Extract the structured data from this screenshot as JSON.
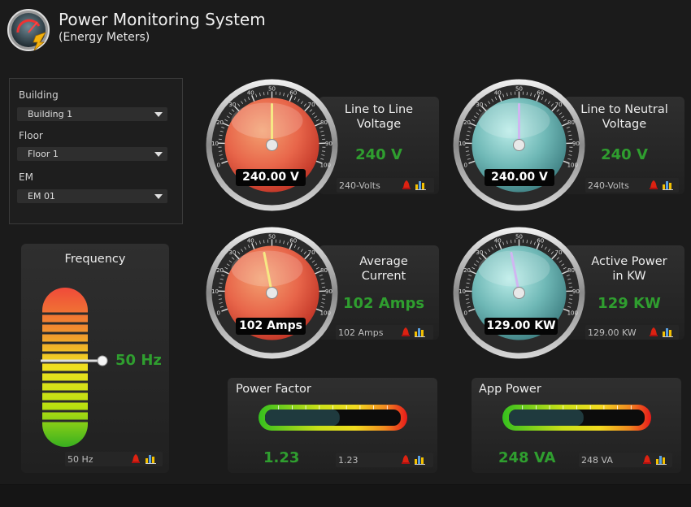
{
  "header": {
    "title": "Power Monitoring System",
    "subtitle": "(Energy Meters)",
    "logo_icon": "speedometer-icon"
  },
  "selectors": {
    "building": {
      "label": "Building",
      "value": "Building 1"
    },
    "floor": {
      "label": "Floor",
      "value": "Floor 1"
    },
    "em": {
      "label": "EM",
      "value": "EM 01"
    }
  },
  "frequency": {
    "title": "Frequency",
    "value_text": "50 Hz",
    "box_text": "50 Hz",
    "level_fraction": 0.5
  },
  "gauges": {
    "ll_voltage": {
      "title_line1": "Line to Line",
      "title_line2": "Voltage",
      "readout": "240.00 V",
      "big_value": "240 V",
      "box_text": "240-Volts",
      "theme": "red",
      "scale_labels": [
        "0",
        "10",
        "20",
        "30",
        "40",
        "50",
        "60",
        "70",
        "80",
        "90",
        "100"
      ],
      "needle_value": 50
    },
    "ln_voltage": {
      "title_line1": "Line to Neutral",
      "title_line2": "Voltage",
      "readout": "240.00 V",
      "big_value": "240 V",
      "box_text": "240-Volts",
      "theme": "teal",
      "scale_labels": [
        "0",
        "10",
        "20",
        "30",
        "40",
        "50",
        "60",
        "70",
        "80",
        "90",
        "100"
      ],
      "needle_value": 50
    },
    "avg_current": {
      "title_line1": "Average",
      "title_line2": "Current",
      "readout": "102 Amps",
      "big_value": "102 Amps",
      "box_text": "102 Amps",
      "theme": "red",
      "scale_labels": [
        "0",
        "10",
        "20",
        "30",
        "40",
        "50",
        "60",
        "70",
        "80",
        "90",
        "100"
      ],
      "needle_value": 45
    },
    "active_power": {
      "title_line1": "Active Power",
      "title_line2": "in KW",
      "readout": "129.00 KW",
      "big_value": "129 KW",
      "box_text": "129.00 KW",
      "theme": "teal",
      "scale_labels": [
        "0",
        "10",
        "20",
        "30",
        "40",
        "50",
        "60",
        "70",
        "80",
        "90",
        "100"
      ],
      "needle_value": 45
    }
  },
  "linear": {
    "power_factor": {
      "title": "Power Factor",
      "big_value": "1.23",
      "box_text": "1.23",
      "fill_fraction": 0.55
    },
    "app_power": {
      "title": "App Power",
      "big_value": "248 VA",
      "box_text": "248 VA",
      "fill_fraction": 0.55
    }
  },
  "icons": {
    "alarm": "alarm-bell-icon",
    "chart": "bar-chart-icon"
  },
  "colors": {
    "value_green": "#2f9e2f",
    "background": "#1b1b1b"
  }
}
